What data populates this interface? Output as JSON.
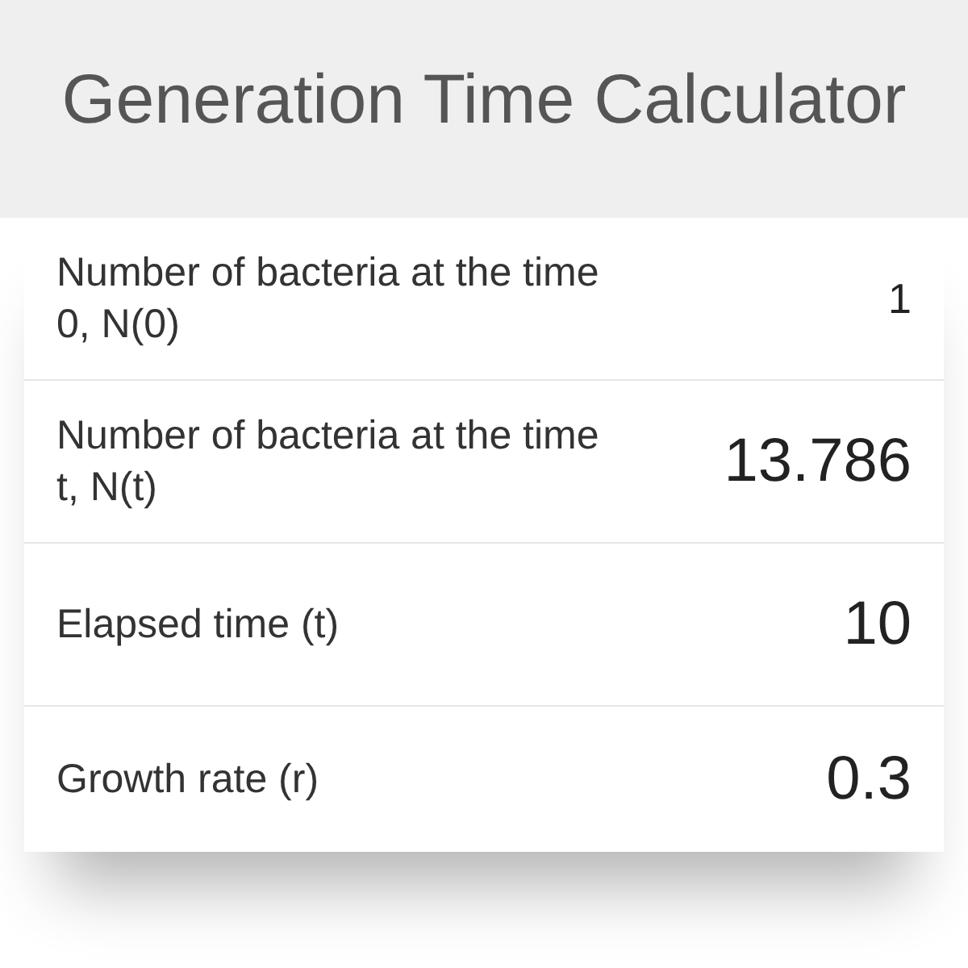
{
  "title": "Generation Time Calculator",
  "fields": [
    {
      "label": "Number of bacteria at the time 0, N(0)",
      "value": "1",
      "kind": "compact"
    },
    {
      "label": "Number of bacteria at the time t, N(t)",
      "value": "13.786",
      "kind": "large"
    },
    {
      "label": "Elapsed time (t)",
      "value": "10",
      "kind": "large"
    },
    {
      "label": "Growth rate (r)",
      "value": "0.3",
      "kind": "large"
    }
  ]
}
